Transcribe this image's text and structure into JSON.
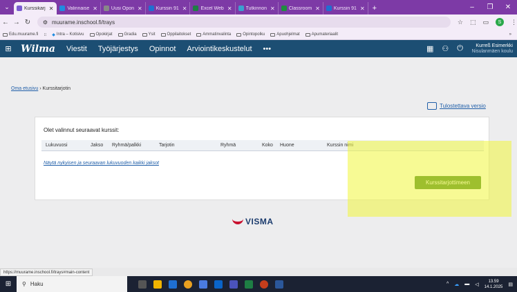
{
  "browser": {
    "tabs": [
      {
        "label": "Kurssikarj",
        "color": "#7a5bd1",
        "active": false
      },
      {
        "label": "Valinnaise",
        "color": "#1f8be0",
        "active": false
      },
      {
        "label": "Uusi Opon",
        "color": "#888888",
        "active": false
      },
      {
        "label": "Kurssin 91",
        "color": "#1f6fd1",
        "active": false
      },
      {
        "label": "Excel Web",
        "color": "#1e7e44",
        "active": false
      },
      {
        "label": "Tutkinnon",
        "color": "#3aa0d0",
        "active": false
      },
      {
        "label": "Classroom",
        "color": "#1e8e3e",
        "active": false
      },
      {
        "label": "Kurssin 91",
        "color": "#1f6fd1",
        "active": false
      }
    ],
    "url": "muurame.inschool.fi/trays",
    "bookmarks": [
      "Edu.muurame.fi",
      "Intra – Kotisivu",
      "Opokirjat",
      "Gradia",
      "Ysit",
      "Oppilaitokset",
      "Ammatinvalinta",
      "Opintopolku",
      "Apuohjelmat",
      "Apumateriaalit"
    ],
    "profile_initial": "S",
    "more": "»"
  },
  "wilma": {
    "logo": "Wilma",
    "nav": [
      "Viestit",
      "Työjärjestys",
      "Opinnot",
      "Arviointikeskustelut",
      "•••"
    ],
    "user_name": "Kurreß Esimerkki",
    "user_school": "Nisulanmäen koulu"
  },
  "page": {
    "breadcrumb_home": "Oma etusivu",
    "breadcrumb_sep": "›",
    "breadcrumb_current": "Kurssitarjotin",
    "print_label": "Tulostettava versio",
    "panel_title": "Olet valinnut seuraavat kurssit:",
    "columns": [
      "Lukuvuosi",
      "Jakso",
      "Ryhmä/palkki",
      "Tarjotin",
      "Ryhmä",
      "Koko",
      "Huone",
      "Kurssin nimi"
    ],
    "show_all_link": "Näytä nykyisen ja seuraavan lukuvuoden kaikki jaksot",
    "offer_button": "Kurssitarjottimeen",
    "brand": "VISMA",
    "status_url": "https://muurame.inschool.fi/trays#main-content"
  },
  "taskbar": {
    "search_placeholder": "Haku",
    "time": "13.59",
    "date": "14.1.2025"
  },
  "colors": {
    "browser_frame": "#7d3aa6",
    "wilma_header": "#1c4e73",
    "button_green": "#3a7d1e",
    "highlight": "#f1f53c"
  }
}
